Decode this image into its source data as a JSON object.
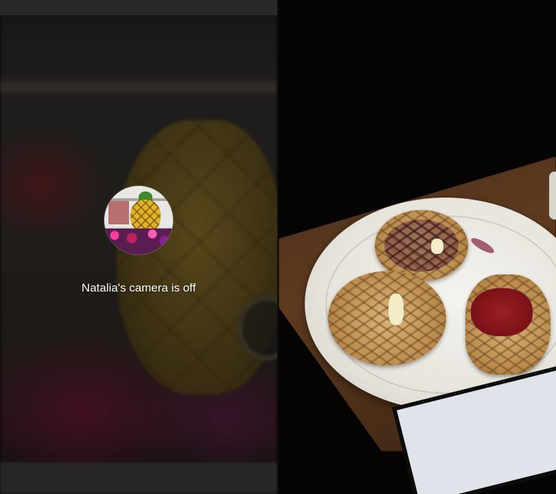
{
  "participants": [
    {
      "name": "Natalia",
      "status_text": "Natalia's camera is off",
      "avatar_icon": "profile-photo-pineapple-house"
    }
  ],
  "colors": {
    "label_text": "#ffffff",
    "background": "#000000"
  }
}
